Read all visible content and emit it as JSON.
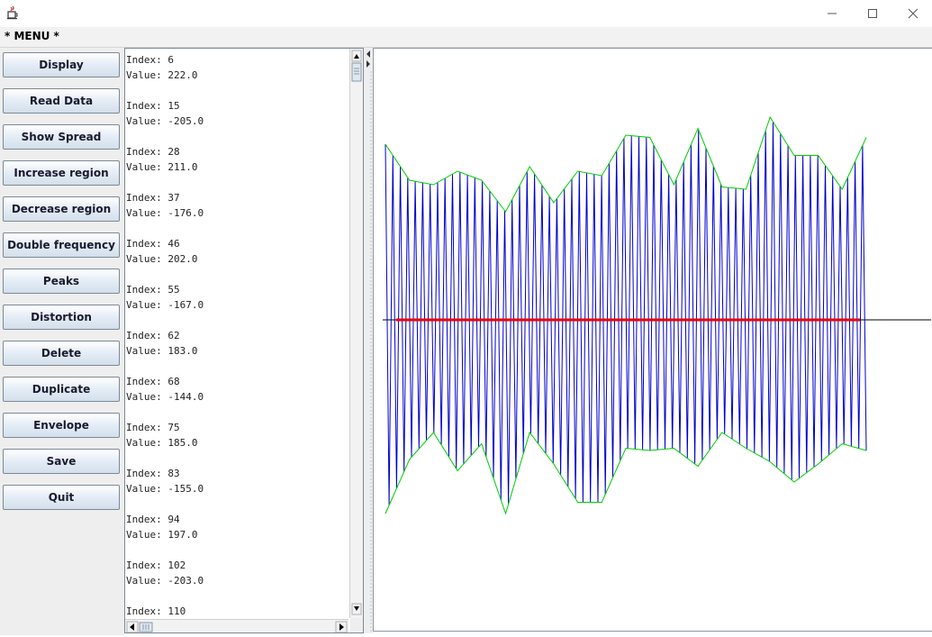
{
  "window": {
    "title": "",
    "app_icon": "java-cup-icon",
    "controls": {
      "minimize": "—",
      "maximize": "☐",
      "close": "✕"
    }
  },
  "menu": {
    "label": "* MENU *"
  },
  "buttons": [
    "Display",
    "Read Data",
    "Show Spread",
    "Increase region",
    "Decrease region",
    "Double frequency",
    "Peaks",
    "Distortion",
    "Delete",
    "Duplicate",
    "Envelope",
    "Save",
    "Quit"
  ],
  "list": {
    "entries": [
      {
        "index": "Index: 6",
        "value": "Value: 222.0"
      },
      {
        "index": "Index: 15",
        "value": "Value: -205.0"
      },
      {
        "index": "Index: 28",
        "value": "Value: 211.0"
      },
      {
        "index": "Index: 37",
        "value": "Value: -176.0"
      },
      {
        "index": "Index: 46",
        "value": "Value: 202.0"
      },
      {
        "index": "Index: 55",
        "value": "Value: -167.0"
      },
      {
        "index": "Index: 62",
        "value": "Value: 183.0"
      },
      {
        "index": "Index: 68",
        "value": "Value: -144.0"
      },
      {
        "index": "Index: 75",
        "value": "Value: 185.0"
      },
      {
        "index": "Index: 83",
        "value": "Value: -155.0"
      },
      {
        "index": "Index: 94",
        "value": "Value: 197.0"
      },
      {
        "index": "Index: 102",
        "value": "Value: -203.0"
      },
      {
        "index": "Index: 110",
        "value": ""
      }
    ]
  },
  "plot": {
    "colors": {
      "waveform": "#0000cc",
      "envelope": "#00cc00",
      "region": "#ee0000",
      "axis": "#000000"
    },
    "sample_count": 130,
    "envelope_upper": [
      0.78,
      0.62,
      0.6,
      0.66,
      0.62,
      0.48,
      0.68,
      0.52,
      0.66,
      0.64,
      0.82,
      0.81,
      0.6,
      0.85,
      0.59,
      0.58,
      0.9,
      0.73,
      0.73,
      0.58,
      0.81
    ],
    "envelope_lower": [
      -0.86,
      -0.62,
      -0.5,
      -0.67,
      -0.55,
      -0.86,
      -0.5,
      -0.64,
      -0.81,
      -0.81,
      -0.57,
      -0.58,
      -0.57,
      -0.65,
      -0.5,
      -0.57,
      -0.63,
      -0.72,
      -0.64,
      -0.55,
      -0.58
    ]
  }
}
